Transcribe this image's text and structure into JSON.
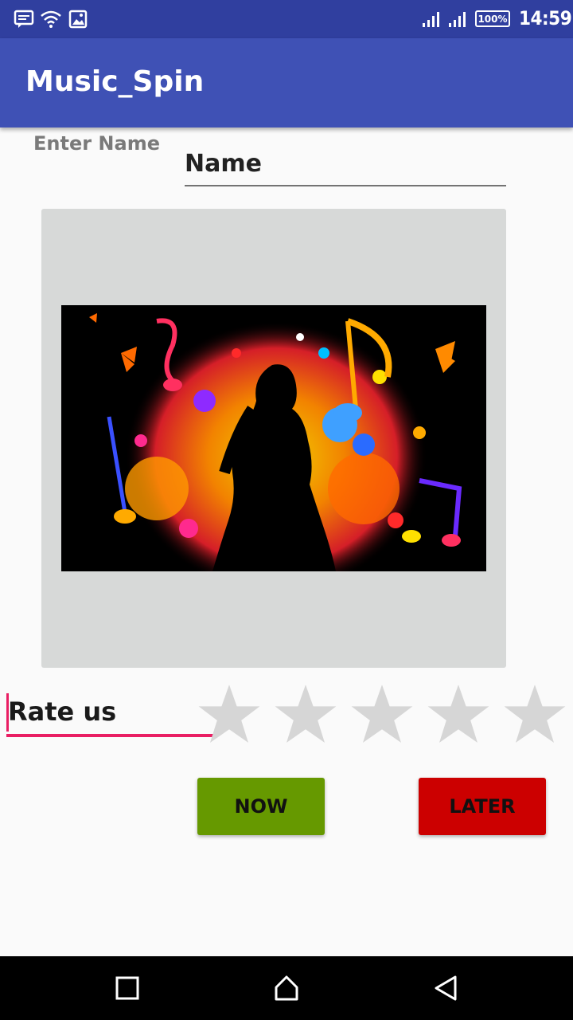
{
  "status_bar": {
    "battery": "100%",
    "time": "14:59",
    "icons": [
      "message-icon",
      "wifi-icon",
      "image-icon",
      "signal-icon",
      "signal-icon"
    ]
  },
  "app_bar": {
    "title": "Music_Spin"
  },
  "form": {
    "enter_name_label": "Enter Name",
    "name_placeholder": "Name"
  },
  "image": {
    "description_icon": "music-silhouette-image"
  },
  "rating": {
    "label": "Rate us",
    "max_stars": 5,
    "value": 0
  },
  "buttons": {
    "now": "NOW",
    "later": "LATER"
  },
  "colors": {
    "primary": "#3f51b5",
    "primary_dark": "#303f9f",
    "accent": "#e91e63",
    "now_button": "#669900",
    "later_button": "#cc0000"
  }
}
